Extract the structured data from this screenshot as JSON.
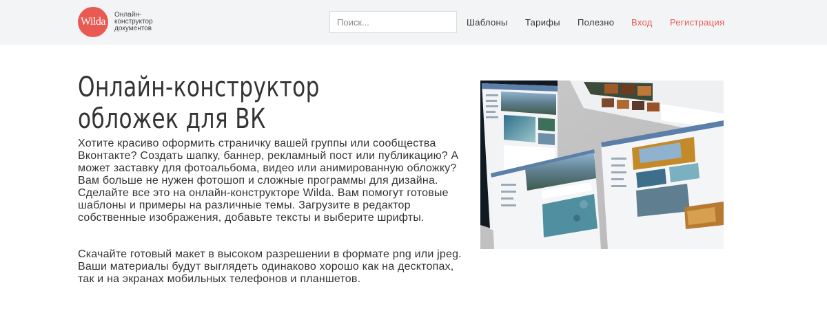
{
  "header": {
    "logo_text": "Wilda",
    "tagline": "Онлайн-\nконструктор\nдокументов",
    "search_placeholder": "Поиск...",
    "nav": [
      {
        "label": "Шаблоны"
      },
      {
        "label": "Тарифы"
      },
      {
        "label": "Полезно"
      },
      {
        "label": "Вход"
      },
      {
        "label": "Регистрация"
      }
    ]
  },
  "main": {
    "title": "Онлайн-конструктор обложек для ВК",
    "paragraphs": [
      "Хотите красиво оформить страничку вашей группы или сообщества Вконтакте? Создать шапку, баннер, рекламный пост или публикацию? А может заставку для фотоальбома, видео или анимированную обложку? Вам больше не нужен фотошоп и сложные программы для дизайна. Сделайте все это на онлайн-конструкторе Wilda. Вам помогут готовые шаблоны и примеры на различные темы. Загрузите в редактор собственные изображения, добавьте тексты и выберите шрифты.",
      "Скачайте готовый макет в высоком разрешении в формате png или jpeg. Ваши материалы будут выглядеть одинаково хорошо как на десктопах, так и на экранах мобильных телефонов и планшетов."
    ]
  },
  "colors": {
    "brand": "#e85a52",
    "header_bg": "#f3f4f6",
    "text": "#333333",
    "vk_blue": "#5b7fa8"
  }
}
